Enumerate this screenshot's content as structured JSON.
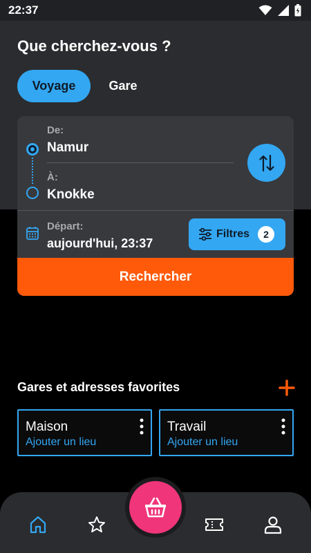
{
  "status_bar": {
    "time": "22:37"
  },
  "header": {
    "title": "Que cherchez-vous ?"
  },
  "tabs": [
    {
      "label": "Voyage",
      "active": true
    },
    {
      "label": "Gare",
      "active": false
    }
  ],
  "route": {
    "from_label": "De:",
    "from_value": "Namur",
    "to_label": "À:",
    "to_value": "Knokke"
  },
  "departure": {
    "label": "Départ:",
    "value": "aujourd'hui, 23:37"
  },
  "filters": {
    "label": "Filtres",
    "count": "2"
  },
  "search_button": {
    "label": "Rechercher"
  },
  "favorites": {
    "title": "Gares et adresses favorites",
    "items": [
      {
        "name": "Maison",
        "action": "Ajouter un lieu"
      },
      {
        "name": "Travail",
        "action": "Ajouter un lieu"
      }
    ]
  },
  "bottom_nav": {
    "items": [
      "home-icon",
      "star-icon",
      "basket-icon",
      "ticket-icon",
      "person-icon"
    ],
    "active": "home-icon"
  },
  "colors": {
    "accent_blue": "#33a7f2",
    "accent_orange": "#ff5a0a",
    "fab_pink": "#f0357a",
    "panel": "#2b2c2f"
  }
}
